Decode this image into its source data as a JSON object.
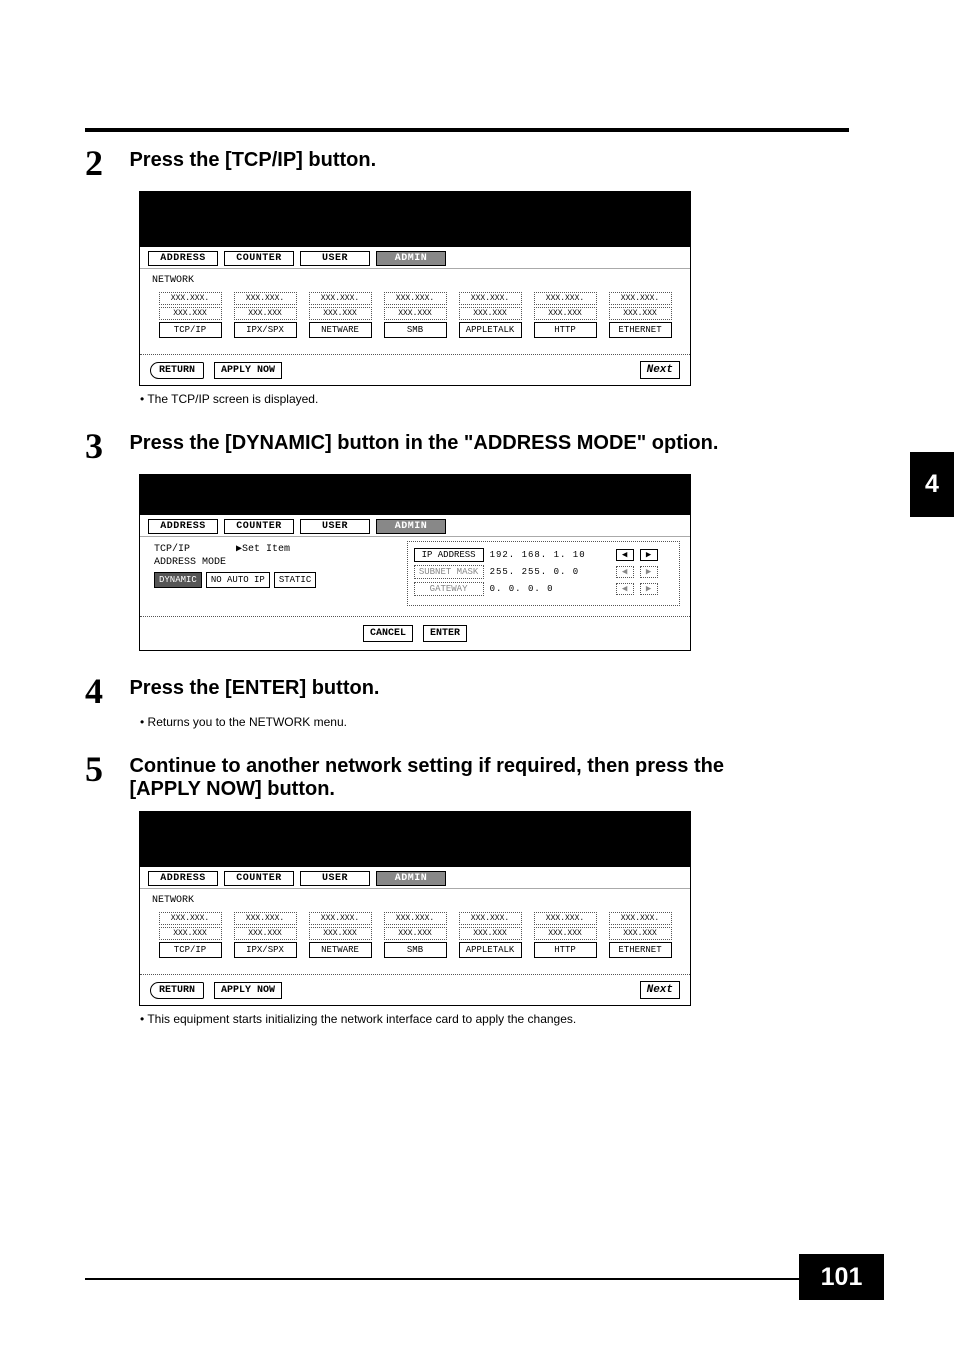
{
  "side_tab": "4",
  "page_number": "101",
  "steps": {
    "s2": {
      "num": "2",
      "title": "Press the [TCP/IP] button.",
      "bullet": "The TCP/IP screen is displayed."
    },
    "s3": {
      "num": "3",
      "title": "Press the [DYNAMIC] button in the \"ADDRESS MODE\" option."
    },
    "s4": {
      "num": "4",
      "title": "Press the [ENTER] button.",
      "bullet": "Returns you to the NETWORK menu."
    },
    "s5": {
      "num": "5",
      "title": "Continue to another network setting if required, then press the [APPLY NOW] button.",
      "bullet": "This equipment starts initializing the network interface card to apply the changes."
    }
  },
  "tabs": {
    "address": "ADDRESS",
    "counter": "COUNTER",
    "user": "USER",
    "admin": "ADMIN"
  },
  "network_screen": {
    "label": "NETWORK",
    "placeholder1": "XXX.XXX.",
    "placeholder2": "XXX.XXX",
    "cols": [
      "TCP/IP",
      "IPX/SPX",
      "NETWARE",
      "SMB",
      "APPLETALK",
      "HTTP",
      "ETHERNET"
    ],
    "return": "RETURN",
    "apply": "APPLY NOW",
    "next": "Next"
  },
  "tcpip_screen": {
    "crumb_left": "TCP/IP",
    "crumb_right": "▶Set Item",
    "mode_label": "ADDRESS MODE",
    "modes": {
      "dynamic": "DYNAMIC",
      "noautoip": "NO AUTO IP",
      "static": "STATIC"
    },
    "rows": {
      "ip": {
        "label": "IP ADDRESS",
        "value": "192. 168.   1.  10"
      },
      "mask": {
        "label": "SUBNET MASK",
        "value": "255. 255.   0.   0"
      },
      "gw": {
        "label": "GATEWAY",
        "value": "  0.   0.   0.   0"
      }
    },
    "arrows": {
      "left": "◀",
      "right": "▶"
    },
    "cancel": "CANCEL",
    "enter": "ENTER"
  }
}
